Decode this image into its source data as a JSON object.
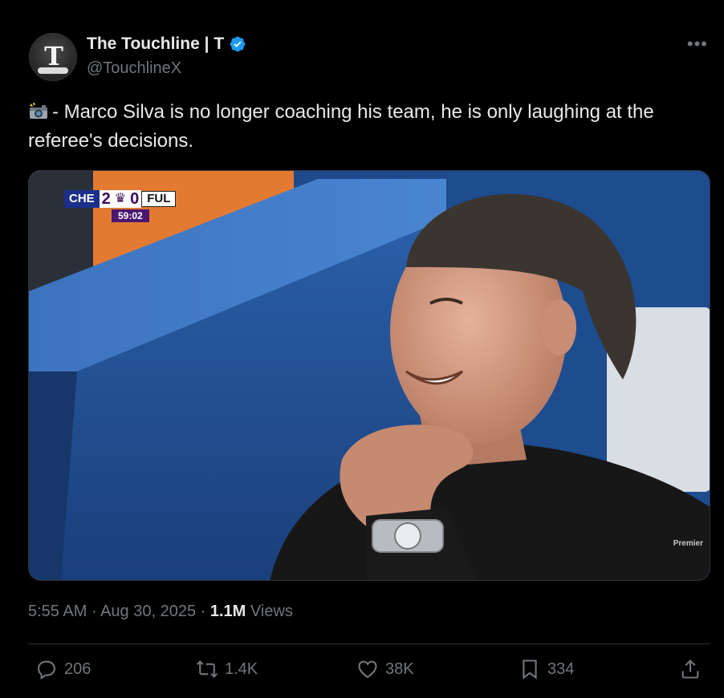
{
  "author": {
    "display_name": "The Touchline | T",
    "handle": "@TouchlineX",
    "avatar_icon": "touchline-logo-icon",
    "verified": true
  },
  "tweet": {
    "emoji_icon": "camera-flash-icon",
    "text": "- Marco Silva is no longer coaching his team, he is only laughing at the referee's decisions."
  },
  "media": {
    "scoreboard": {
      "home": "CHE",
      "home_score": "2",
      "away_score": "0",
      "away": "FUL",
      "clock": "59:02"
    },
    "watermark": "Premier"
  },
  "meta": {
    "time": "5:55 AM",
    "date": "Aug 30, 2025",
    "views_count": "1.1M",
    "views_label": "Views",
    "separator": "·"
  },
  "actions": {
    "replies": "206",
    "reposts": "1.4K",
    "likes": "38K",
    "bookmarks": "334"
  },
  "colors": {
    "background": "#000000",
    "text": "#e7e9ea",
    "muted": "#71767b",
    "verified": "#1d9bf0",
    "divider": "#2f3336"
  }
}
